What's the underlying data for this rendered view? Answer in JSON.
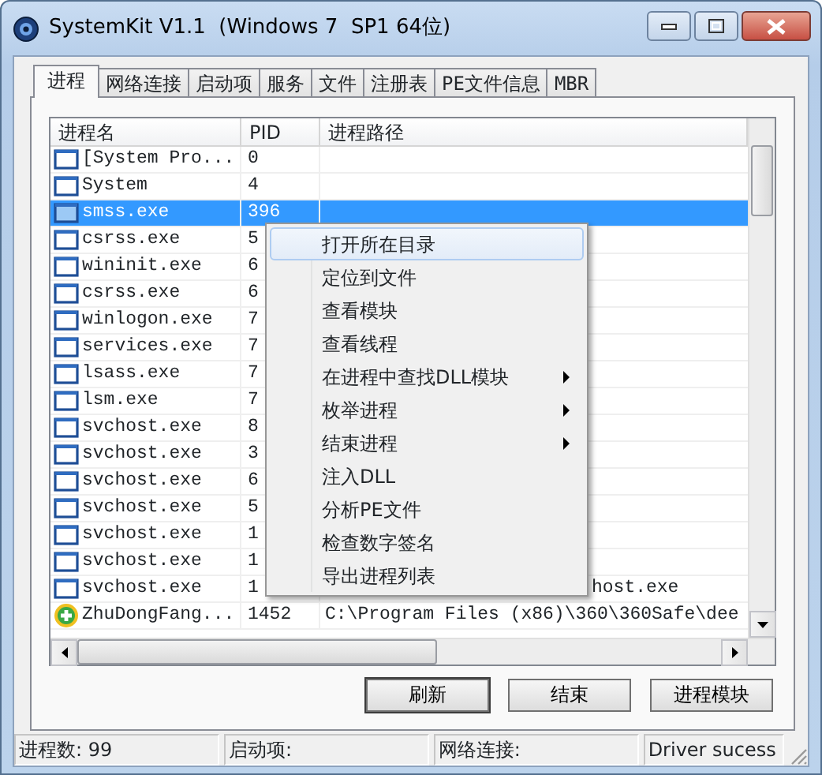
{
  "window": {
    "title": "SystemKit V1.1  (Windows 7  SP1 64位)"
  },
  "tabs": [
    {
      "label": "进程",
      "selected": true
    },
    {
      "label": "网络连接",
      "selected": false
    },
    {
      "label": "启动项",
      "selected": false
    },
    {
      "label": "服务",
      "selected": false
    },
    {
      "label": "文件",
      "selected": false
    },
    {
      "label": "注册表",
      "selected": false
    },
    {
      "label": "PE文件信息",
      "selected": false
    },
    {
      "label": "MBR",
      "selected": false
    }
  ],
  "process_table": {
    "columns": [
      "进程名",
      "PID",
      "进程路径"
    ],
    "rows": [
      {
        "kind": "window",
        "name": "[System Pro...",
        "pid": "0",
        "path": "",
        "selected": false
      },
      {
        "kind": "window",
        "name": "System",
        "pid": "4",
        "path": "",
        "selected": false
      },
      {
        "kind": "window",
        "name": "smss.exe",
        "pid": "396",
        "path": "",
        "selected": true
      },
      {
        "kind": "window",
        "name": "csrss.exe",
        "pid": "5",
        "path": "",
        "selected": false
      },
      {
        "kind": "window",
        "name": "wininit.exe",
        "pid": "6",
        "path": "",
        "selected": false
      },
      {
        "kind": "window",
        "name": "csrss.exe",
        "pid": "6",
        "path": "",
        "selected": false
      },
      {
        "kind": "window",
        "name": "winlogon.exe",
        "pid": "7",
        "path": "",
        "selected": false
      },
      {
        "kind": "window",
        "name": "services.exe",
        "pid": "7",
        "path": "",
        "selected": false
      },
      {
        "kind": "window",
        "name": "lsass.exe",
        "pid": "7",
        "path": "",
        "selected": false
      },
      {
        "kind": "window",
        "name": "lsm.exe",
        "pid": "7",
        "path": "",
        "selected": false
      },
      {
        "kind": "window",
        "name": "svchost.exe",
        "pid": "8",
        "path": "",
        "selected": false
      },
      {
        "kind": "window",
        "name": "svchost.exe",
        "pid": "3",
        "path": "",
        "selected": false
      },
      {
        "kind": "window",
        "name": "svchost.exe",
        "pid": "6",
        "path": "",
        "selected": false
      },
      {
        "kind": "window",
        "name": "svchost.exe",
        "pid": "5",
        "path": "",
        "selected": false
      },
      {
        "kind": "window",
        "name": "svchost.exe",
        "pid": "1",
        "path": "",
        "selected": false
      },
      {
        "kind": "window",
        "name": "svchost.exe",
        "pid": "1",
        "path": "",
        "selected": false
      },
      {
        "kind": "window",
        "name": "svchost.exe",
        "pid": "1",
        "path": "host.exe",
        "selected": false
      },
      {
        "kind": "shield",
        "name": "ZhuDongFang...",
        "pid": "1452",
        "path": "C:\\Program Files (x86)\\360\\360Safe\\dee",
        "selected": false
      }
    ]
  },
  "context_menu": [
    {
      "label": "打开所在目录",
      "selected": true,
      "has_submenu": false
    },
    {
      "label": "定位到文件",
      "selected": false,
      "has_submenu": false
    },
    {
      "label": "查看模块",
      "selected": false,
      "has_submenu": false
    },
    {
      "label": "查看线程",
      "selected": false,
      "has_submenu": false
    },
    {
      "label": "在进程中查找DLL模块",
      "selected": false,
      "has_submenu": true
    },
    {
      "label": "枚举进程",
      "selected": false,
      "has_submenu": true
    },
    {
      "label": "结束进程",
      "selected": false,
      "has_submenu": true
    },
    {
      "label": "注入DLL",
      "selected": false,
      "has_submenu": false
    },
    {
      "label": "分析PE文件",
      "selected": false,
      "has_submenu": false
    },
    {
      "label": "检查数字签名",
      "selected": false,
      "has_submenu": false
    },
    {
      "label": "导出进程列表",
      "selected": false,
      "has_submenu": false
    }
  ],
  "buttons": [
    "刷新",
    "结束",
    "进程模块"
  ],
  "status_bar": [
    "进程数: 99",
    "启动项:",
    "网络连接:",
    "Driver sucess"
  ]
}
